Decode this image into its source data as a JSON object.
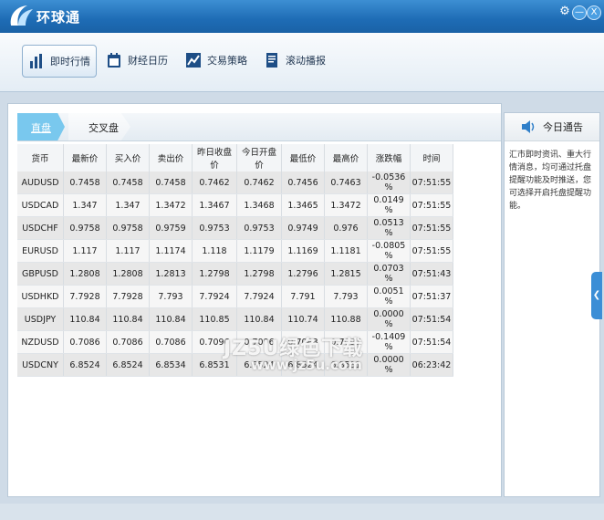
{
  "app": {
    "title": "环球通"
  },
  "window": {
    "settings": "⚙",
    "minimize": "—",
    "close": "X"
  },
  "toolbar": {
    "items": [
      {
        "label": "即时行情"
      },
      {
        "label": "财经日历"
      },
      {
        "label": "交易策略"
      },
      {
        "label": "滚动播报"
      }
    ]
  },
  "tabs": [
    {
      "label": "直盘"
    },
    {
      "label": "交叉盘"
    }
  ],
  "table": {
    "columns": [
      "货币",
      "最新价",
      "买入价",
      "卖出价",
      "昨日收盘价",
      "今日开盘价",
      "最低价",
      "最高价",
      "涨跌幅",
      "时间"
    ],
    "rows": [
      [
        "AUDUSD",
        "0.7458",
        "0.7458",
        "0.7458",
        "0.7462",
        "0.7462",
        "0.7456",
        "0.7463",
        "-0.0536 %",
        "07:51:55"
      ],
      [
        "USDCAD",
        "1.347",
        "1.347",
        "1.3472",
        "1.3467",
        "1.3468",
        "1.3465",
        "1.3472",
        "0.0149 %",
        "07:51:55"
      ],
      [
        "USDCHF",
        "0.9758",
        "0.9758",
        "0.9759",
        "0.9753",
        "0.9753",
        "0.9749",
        "0.976",
        "0.0513 %",
        "07:51:55"
      ],
      [
        "EURUSD",
        "1.117",
        "1.117",
        "1.1174",
        "1.118",
        "1.1179",
        "1.1169",
        "1.1181",
        "-0.0805 %",
        "07:51:55"
      ],
      [
        "GBPUSD",
        "1.2808",
        "1.2808",
        "1.2813",
        "1.2798",
        "1.2798",
        "1.2796",
        "1.2815",
        "0.0703 %",
        "07:51:43"
      ],
      [
        "USDHKD",
        "7.7928",
        "7.7928",
        "7.793",
        "7.7924",
        "7.7924",
        "7.791",
        "7.793",
        "0.0051 %",
        "07:51:37"
      ],
      [
        "USDJPY",
        "110.84",
        "110.84",
        "110.84",
        "110.85",
        "110.84",
        "110.74",
        "110.88",
        "0.0000 %",
        "07:51:54"
      ],
      [
        "NZDUSD",
        "0.7086",
        "0.7086",
        "0.7086",
        "0.7096",
        "0.7096",
        "0.7083",
        "0.7097",
        "-0.1409 %",
        "07:51:54"
      ],
      [
        "USDCNY",
        "6.8524",
        "6.8524",
        "6.8534",
        "6.8531",
        "6.8524",
        "6.8524",
        "6.8531",
        "0.0000 %",
        "06:23:42"
      ]
    ]
  },
  "notice": {
    "title": "今日通告",
    "body": "汇市即时资讯、重大行情消息，均可通过托盘提醒功能及时推送，您可选择开启托盘提醒功能。"
  },
  "side_handle": "❮",
  "watermark": {
    "line1": "JZ5U绿色下载",
    "line2": "www.jz5u.com"
  }
}
